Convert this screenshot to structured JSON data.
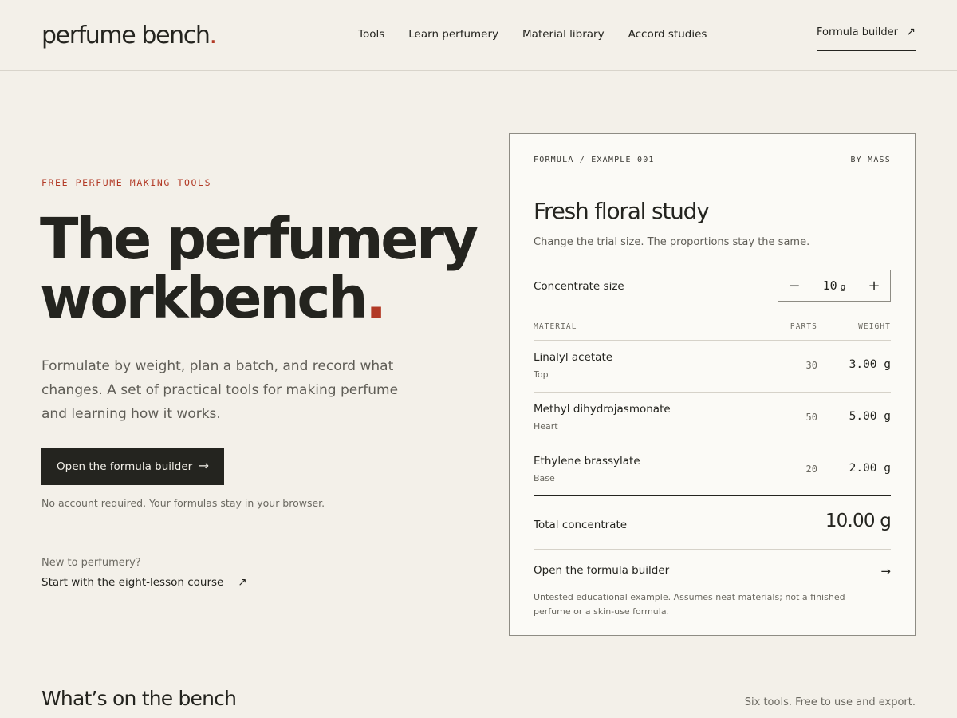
{
  "header": {
    "logo": "perfume bench",
    "logo_dot": ".",
    "nav": [
      "Tools",
      "Learn perfumery",
      "Material library",
      "Accord studies"
    ],
    "formula_builder_link": "Formula builder",
    "arrow_icon": "↗"
  },
  "hero": {
    "eyebrow": "FREE PERFUME MAKING TOOLS",
    "title_line1": "The perfumery",
    "title_line2": "workbench",
    "title_dot": ".",
    "description": "Formulate by weight, plan a batch, and record what changes. A set of practical tools for making perfume and learning how it works.",
    "cta_label": "Open the formula builder",
    "cta_icon": "→",
    "note": "No account required. Your formulas stay in your browser.",
    "new_to": "New to perfumery?",
    "course_link": "Start with the eight-lesson course",
    "course_icon": "↗"
  },
  "card": {
    "label": "FORMULA / EXAMPLE 001",
    "mode": "BY MASS",
    "title": "Fresh floral study",
    "subtitle": "Change the trial size. The proportions stay the same.",
    "concentrate_label": "Concentrate size",
    "concentrate_value": "10",
    "concentrate_unit": "g",
    "minus_icon": "−",
    "plus_icon": "+",
    "columns": [
      "MATERIAL",
      "PARTS",
      "WEIGHT"
    ],
    "rows": [
      {
        "material": "Linalyl acetate",
        "note": "Top",
        "parts": "30",
        "weight": "3.00 g"
      },
      {
        "material": "Methyl dihydrojasmonate",
        "note": "Heart",
        "parts": "50",
        "weight": "5.00 g"
      },
      {
        "material": "Ethylene brassylate",
        "note": "Base",
        "parts": "20",
        "weight": "2.00 g"
      }
    ],
    "total_label": "Total concentrate",
    "total_value": "10.00 g",
    "open_link": "Open the formula builder",
    "open_icon": "→",
    "disclaimer": "Untested educational example. Assumes neat materials; not a finished perfume or a skin-use formula."
  },
  "bench": {
    "title": "What’s on the bench",
    "subtitle": "Six tools. Free to use and export."
  },
  "colors": {
    "background": "#f3f0e9",
    "accent": "#b23a26",
    "ink": "#24241f",
    "card": "#fbfaf6"
  }
}
